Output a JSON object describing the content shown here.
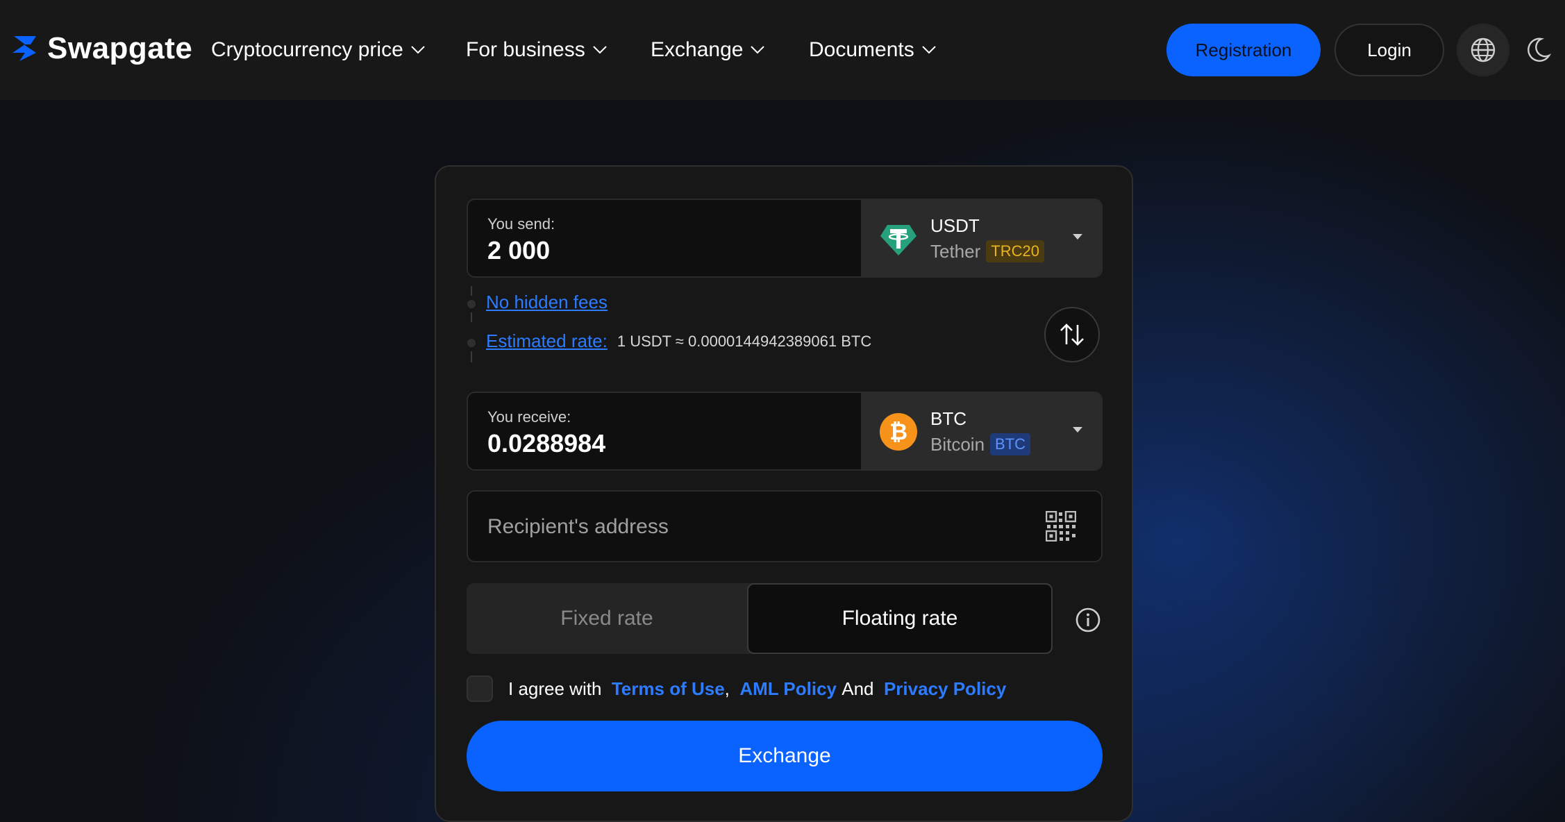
{
  "header": {
    "brand": "Swapgate",
    "nav": [
      {
        "label": "Cryptocurrency price"
      },
      {
        "label": "For business"
      },
      {
        "label": "Exchange"
      },
      {
        "label": "Documents"
      }
    ],
    "registration_label": "Registration",
    "login_label": "Login",
    "icons": {
      "language": "globe-icon",
      "theme": "moon-icon",
      "menu_chevron": "chevron-down-icon"
    }
  },
  "exchange_form": {
    "send": {
      "label": "You send:",
      "amount": "2 000",
      "coin_symbol": "USDT",
      "coin_name": "Tether",
      "network": "TRC20",
      "icon": "tether-icon"
    },
    "no_hidden_fees": "No hidden fees",
    "estimated_rate_label": "Estimated rate:",
    "estimated_rate_value": "1 USDT ≈ 0.0000144942389061 BTC",
    "receive": {
      "label": "You receive:",
      "amount": "0.0288984",
      "coin_symbol": "BTC",
      "coin_name": "Bitcoin",
      "network": "BTC",
      "icon": "bitcoin-icon"
    },
    "recipient_address_placeholder": "Recipient's address",
    "rate_types": {
      "fixed": "Fixed rate",
      "floating": "Floating rate",
      "selected": "Floating rate"
    },
    "agreement": {
      "prefix": "I agree with",
      "terms": "Terms of Use",
      "sep": ",",
      "aml": "AML Policy",
      "and": "And",
      "privacy": "Privacy Policy",
      "checked": false
    },
    "submit_label": "Exchange"
  },
  "colors": {
    "accent": "#0a63ff",
    "link": "#2d7bff",
    "tether": "#26a17b",
    "bitcoin": "#f7931a",
    "trc20_tag": "#e9b321"
  }
}
